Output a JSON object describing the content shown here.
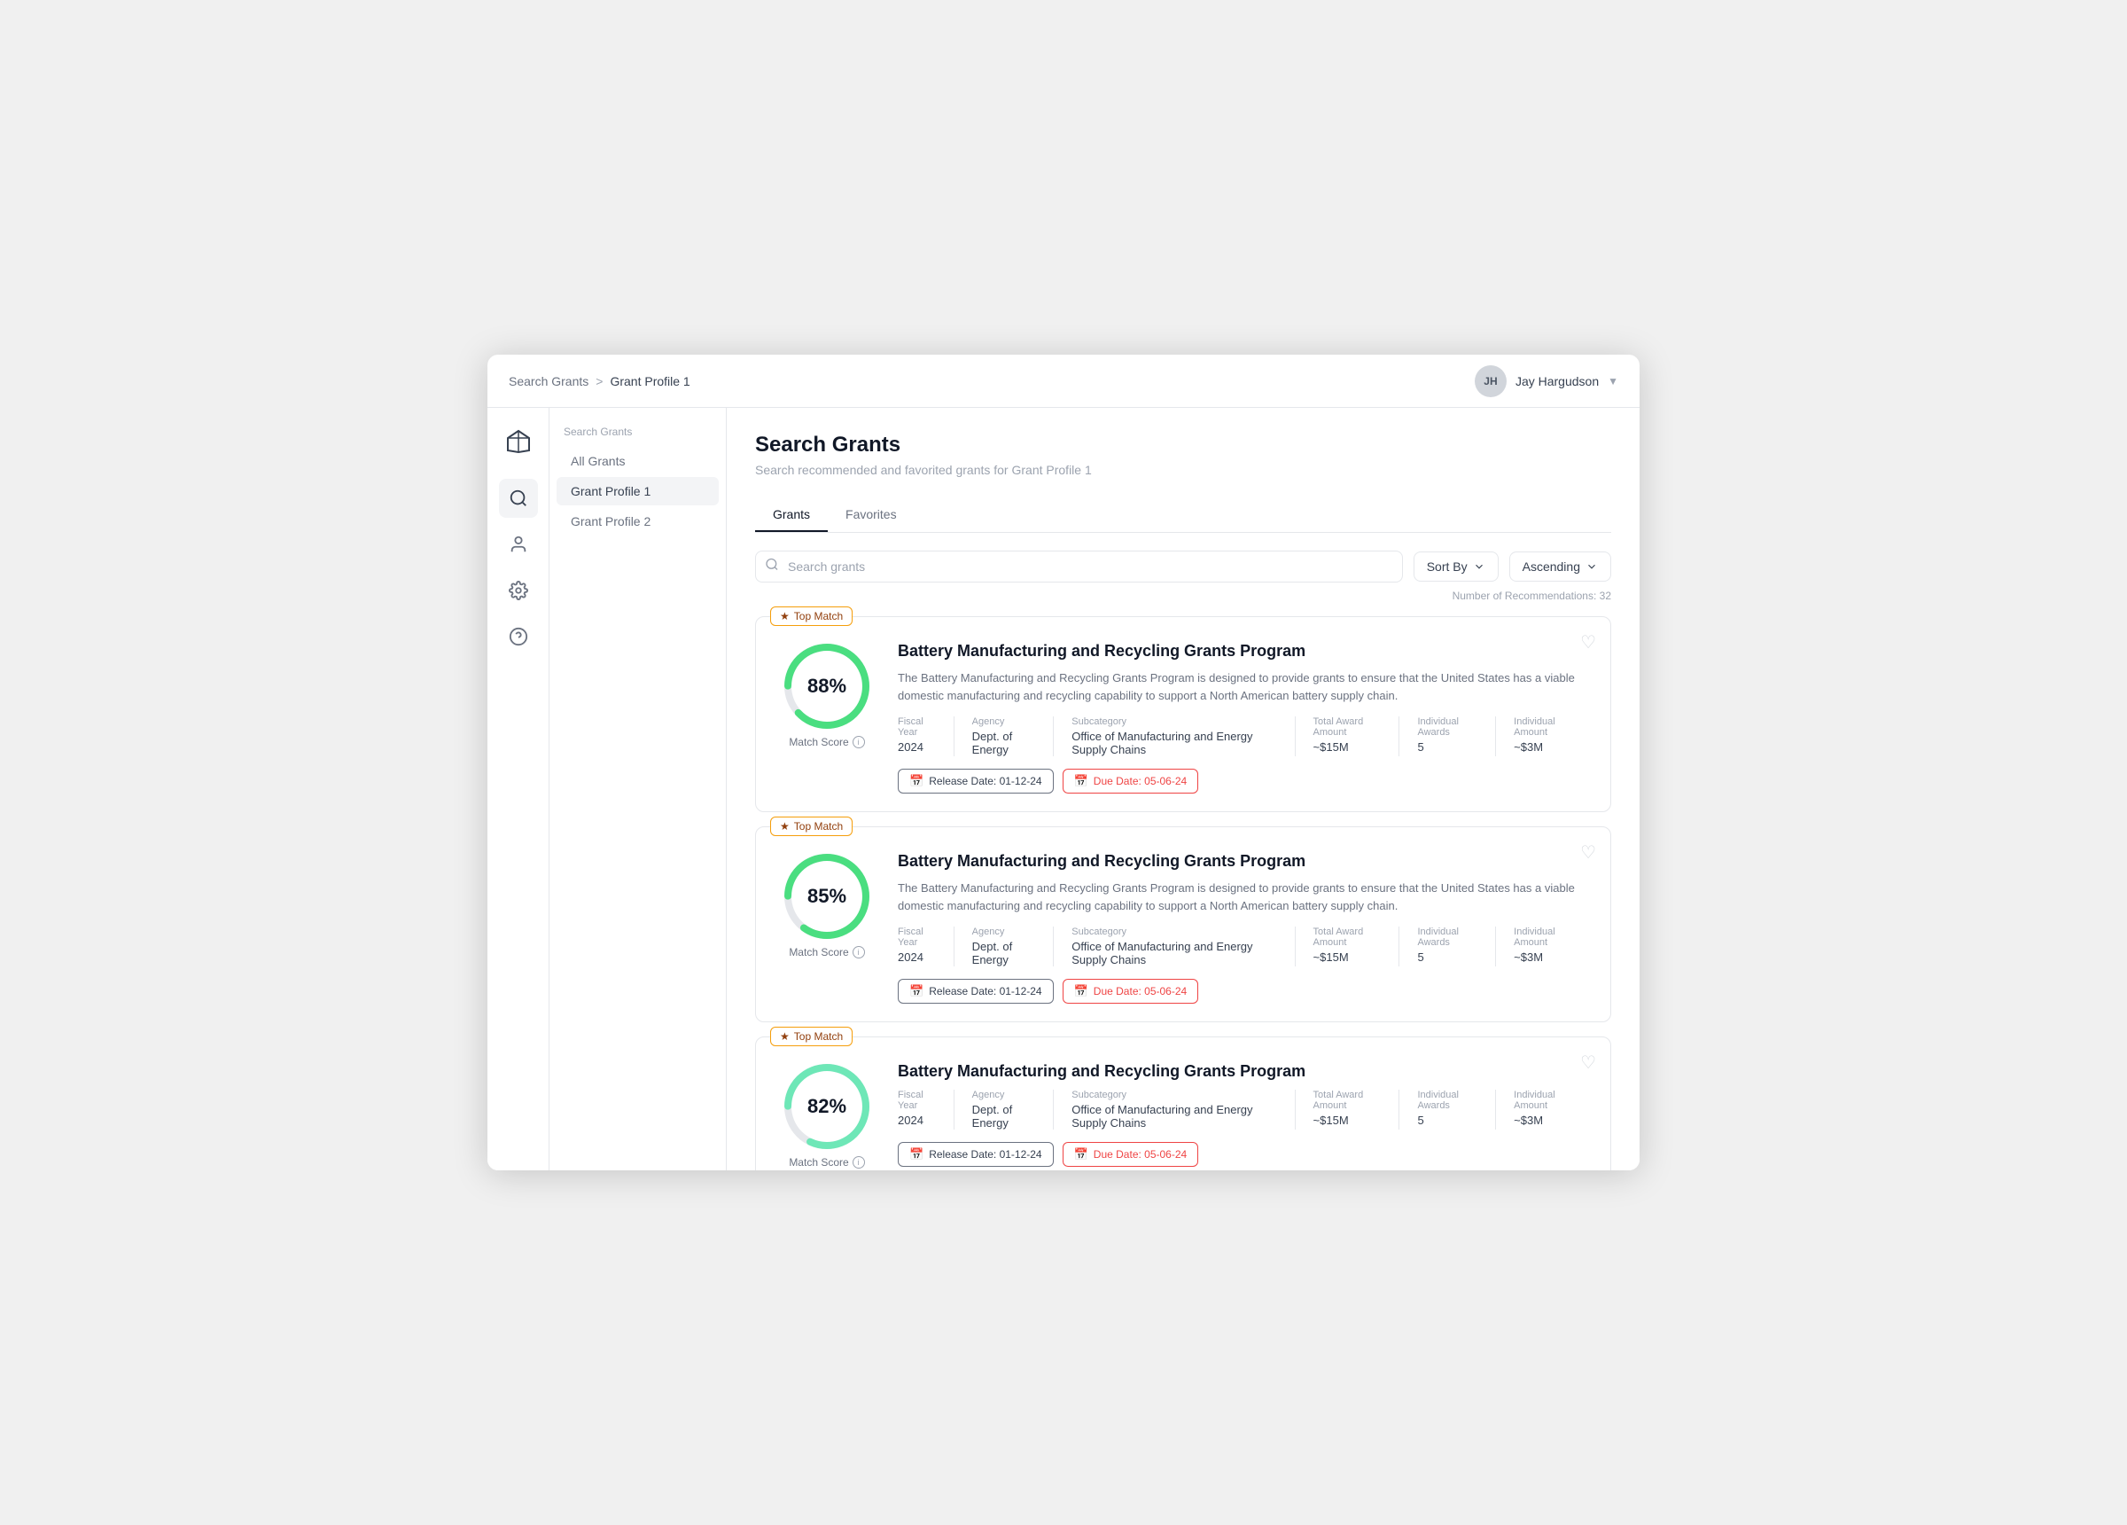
{
  "window": {
    "title": "Search Grants"
  },
  "topbar": {
    "breadcrumb_start": "Search Grants",
    "breadcrumb_sep": ">",
    "breadcrumb_end": "Grant Profile 1",
    "user_initials": "JH",
    "user_name": "Jay Hargudson"
  },
  "icon_sidebar": {
    "icons": [
      {
        "name": "search-icon",
        "label": "Search"
      },
      {
        "name": "person-icon",
        "label": "Profile"
      },
      {
        "name": "settings-icon",
        "label": "Settings"
      },
      {
        "name": "help-icon",
        "label": "Help"
      }
    ]
  },
  "nav_sidebar": {
    "section_label": "Search Grants",
    "items": [
      {
        "label": "All Grants",
        "active": false
      },
      {
        "label": "Grant Profile 1",
        "active": true
      },
      {
        "label": "Grant Profile 2",
        "active": false
      }
    ]
  },
  "page": {
    "title": "Search Grants",
    "subtitle": "Search recommended and favorited grants for Grant Profile 1"
  },
  "tabs": [
    {
      "label": "Grants",
      "active": true
    },
    {
      "label": "Favorites",
      "active": false
    }
  ],
  "search": {
    "placeholder": "Search grants"
  },
  "sort": {
    "sort_by_label": "Sort By",
    "order_label": "Ascending"
  },
  "recommendations_count": "Number of Recommendations: 32",
  "grants": [
    {
      "top_match": true,
      "score": 88,
      "score_label": "Match Score",
      "title": "Battery Manufacturing and Recycling Grants Program",
      "description": "The Battery Manufacturing and Recycling Grants Program is designed to provide grants to ensure that the United States has a viable domestic manufacturing and recycling capability to support a North American battery supply chain.",
      "fiscal_year_label": "Fiscal Year",
      "fiscal_year": "2024",
      "agency_label": "Agency",
      "agency": "Dept. of Energy",
      "subcategory_label": "Subcategory",
      "subcategory": "Office of Manufacturing and Energy Supply Chains",
      "total_award_label": "Total Award Amount",
      "total_award": "~$15M",
      "individual_awards_label": "Individual Awards",
      "individual_awards": "5",
      "individual_amount_label": "Individual Amount",
      "individual_amount": "~$3M",
      "release_date_label": "Release Date: 01-12-24",
      "due_date_label": "Due Date: 05-06-24"
    },
    {
      "top_match": true,
      "score": 85,
      "score_label": "Match Score",
      "title": "Battery Manufacturing and Recycling Grants Program",
      "description": "The Battery Manufacturing and Recycling Grants Program is designed to provide grants to ensure that the United States has a viable domestic manufacturing and recycling capability to support a North American battery supply chain.",
      "fiscal_year_label": "Fiscal Year",
      "fiscal_year": "2024",
      "agency_label": "Agency",
      "agency": "Dept. of Energy",
      "subcategory_label": "Subcategory",
      "subcategory": "Office of Manufacturing and Energy Supply Chains",
      "total_award_label": "Total Award Amount",
      "total_award": "~$15M",
      "individual_awards_label": "Individual Awards",
      "individual_awards": "5",
      "individual_amount_label": "Individual Amount",
      "individual_amount": "~$3M",
      "release_date_label": "Release Date: 01-12-24",
      "due_date_label": "Due Date: 05-06-24"
    },
    {
      "top_match": true,
      "score": 82,
      "score_label": "Match Score",
      "title": "Battery Manufacturing and Recycling Grants Program",
      "description": "",
      "fiscal_year_label": "Fiscal Year",
      "fiscal_year": "2024",
      "agency_label": "Agency",
      "agency": "Dept. of Energy",
      "subcategory_label": "Subcategory",
      "subcategory": "Office of Manufacturing and Energy Supply Chains",
      "total_award_label": "Total Award Amount",
      "total_award": "~$15M",
      "individual_awards_label": "Individual Awards",
      "individual_awards": "5",
      "individual_amount_label": "Individual Amount",
      "individual_amount": "~$3M",
      "release_date_label": "Release Date: 01-12-24",
      "due_date_label": "Due Date: 05-06-24"
    }
  ]
}
